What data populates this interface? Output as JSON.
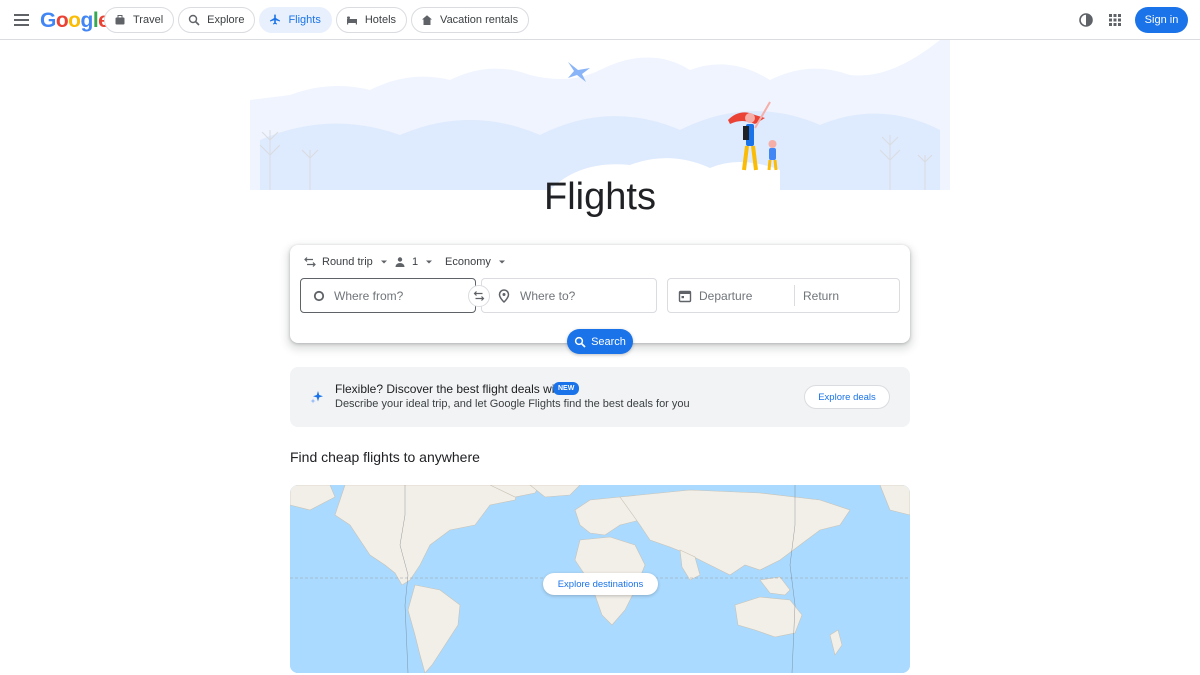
{
  "header": {
    "logo": "Google",
    "nav": [
      {
        "label": "Travel",
        "icon": "suitcase-icon"
      },
      {
        "label": "Explore",
        "icon": "explore-icon"
      },
      {
        "label": "Flights",
        "icon": "plane-icon",
        "active": true
      },
      {
        "label": "Hotels",
        "icon": "bed-icon"
      },
      {
        "label": "Vacation rentals",
        "icon": "house-icon"
      }
    ],
    "sign_in": "Sign in"
  },
  "hero": {
    "title": "Flights"
  },
  "search": {
    "trip_type": "Round trip",
    "passengers": "1",
    "cabin_class": "Economy",
    "from_placeholder": "Where from?",
    "to_placeholder": "Where to?",
    "departure_placeholder": "Departure",
    "return_placeholder": "Return",
    "search_label": "Search"
  },
  "ai_banner": {
    "title": "Flexible? Discover the best flight deals with AI",
    "badge": "NEW",
    "description": "Describe your ideal trip, and let Google Flights find the best deals for you",
    "button": "Explore deals"
  },
  "cheap_flights": {
    "title": "Find cheap flights to anywhere",
    "map_button": "Explore destinations"
  },
  "colors": {
    "accent": "#1a73e8",
    "map_water": "#aadaff",
    "map_land": "#f2efe9"
  }
}
